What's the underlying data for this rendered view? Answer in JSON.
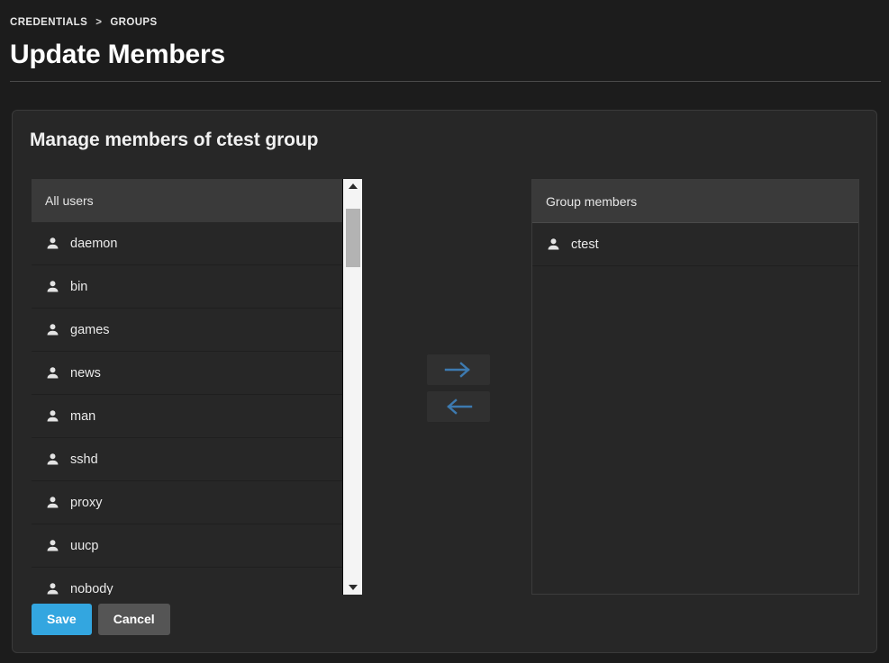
{
  "header": {
    "breadcrumb": {
      "parent": "CREDENTIALS",
      "separator": ">",
      "current": "GROUPS"
    },
    "title": "Update Members"
  },
  "card": {
    "title": "Manage members of ctest group",
    "all_users": {
      "header": "All users",
      "icon": "person-icon",
      "items": [
        {
          "name": "daemon"
        },
        {
          "name": "bin"
        },
        {
          "name": "games"
        },
        {
          "name": "news"
        },
        {
          "name": "man"
        },
        {
          "name": "sshd"
        },
        {
          "name": "proxy"
        },
        {
          "name": "uucp"
        },
        {
          "name": "nobody"
        }
      ]
    },
    "group_members": {
      "header": "Group members",
      "icon": "person-icon",
      "items": [
        {
          "name": "ctest"
        }
      ]
    },
    "transfer": {
      "add_icon": "arrow-right-icon",
      "remove_icon": "arrow-left-icon"
    },
    "footer": {
      "save_label": "Save",
      "cancel_label": "Cancel"
    }
  },
  "colors": {
    "page_background": "#1c1c1c",
    "card_background": "#272727",
    "panel_header": "#3a3a3a",
    "accent_blue": "#33a6e0",
    "arrow_blue": "#3d7ab0",
    "secondary_button": "#555555",
    "scrollbar_track": "#f4f4f4",
    "scrollbar_thumb": "#b3b3b3"
  }
}
